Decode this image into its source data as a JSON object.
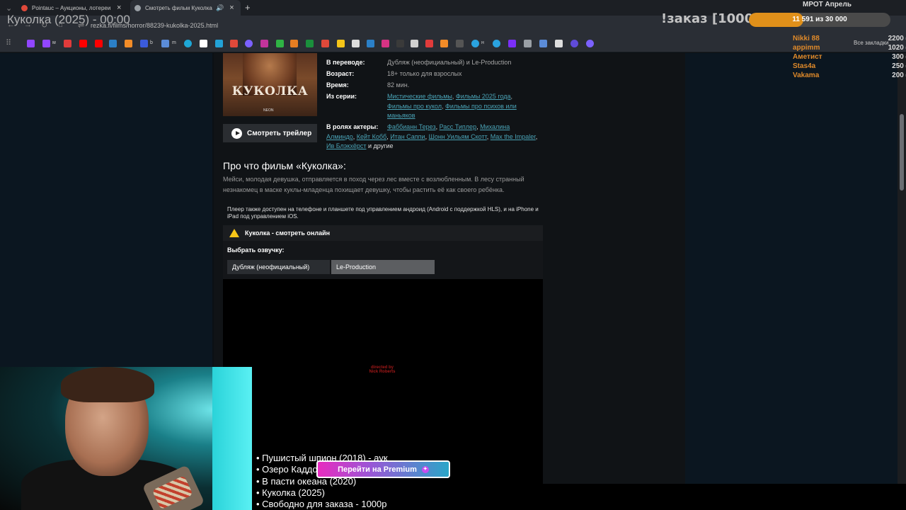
{
  "browser": {
    "tabs": [
      {
        "title": "Pointauc – Аукционы, лотереи",
        "favicon_color": "#e0493a"
      },
      {
        "title": "Смотреть фильм Куколка",
        "favicon_color": "#9aa0a6"
      }
    ],
    "new_tab": "+",
    "url": "rezka.fi/films/horror/88239-kukolka-2025.html",
    "bookmarks_folder": "Все закладки",
    "bookmark_labels": [
      "м",
      "b",
      "m",
      "н"
    ]
  },
  "movie": {
    "poster_title": "КУКОЛКА",
    "poster_logo": "NEON",
    "trailer_button": "Смотреть трейлер",
    "info": {
      "translation_label": "В переводе:",
      "translation_value": "Дубляж (неофициальный) и Le-Production",
      "age_label": "Возраст:",
      "age_value": "18+ только для взрослых",
      "time_label": "Время:",
      "time_value": "82 мин.",
      "series_label": "Из серии:",
      "series_links": [
        "Мистические фильмы",
        "Фильмы 2025 года",
        "Фильмы про кукол",
        "Фильмы про психов или маньяков"
      ],
      "cast_label": "В ролях актеры:",
      "cast_links": [
        "Фаббианн Терез",
        "Расс Типлер",
        "Михалина Алминдо",
        "Кейт Кобб",
        "Итан Саппи",
        "Шонн Уильям Скотт",
        "Max the Impaler",
        "Ив Блэкхёрст"
      ],
      "cast_more": "и другие"
    },
    "about_heading": "Про что фильм «Куколка»:",
    "description": "Мейси, молодая девушка, отправляется в поход через лес вместе с возлюбленным. В лесу странный незнакомец в маске куклы-младенца похищает девушку, чтобы растить её как своего ребёнка.",
    "player_note": "Плеер также доступен на телефоне и планшете под управлением андроид (Android с поддержкой HLS), и на iPhone и iPad под управлением iOS.",
    "watch_bar": "Куколка - смотреть онлайн",
    "voice_label": "Выбрать озвучку:",
    "voices": [
      "Дубляж (неофициальный)",
      "Le-Production"
    ],
    "active_voice": 1,
    "player_credit": "directed by Nick Roberts"
  },
  "stream": {
    "title": "Куколка (2025) - 00:00",
    "order_label": "!заказ [1000р]",
    "goal_text": "11 591  из 30 000",
    "goal_current": 11591,
    "goal_total": 30000,
    "goal_fill_color": "#e0901a",
    "mrot_label": "МРОТ Апрель",
    "donors": [
      {
        "name": "Nikki 88",
        "amount": "2200 ₽"
      },
      {
        "name": "appimm",
        "amount": "1020 ₽"
      },
      {
        "name": "Аметист",
        "amount": "300 ₽"
      },
      {
        "name": "Stas4a",
        "amount": "250 ₽"
      },
      {
        "name": "Vakama",
        "amount": "200 ₽"
      }
    ],
    "queue": [
      "• Пушистый шпион (2018) - аук",
      "• Озеро Каддо (2024) - аук",
      "• В пасти океана (2020)",
      "• Куколка (2025)",
      "• Свободно для заказа - 1000р"
    ],
    "premium_button": "Перейти на Premium"
  }
}
